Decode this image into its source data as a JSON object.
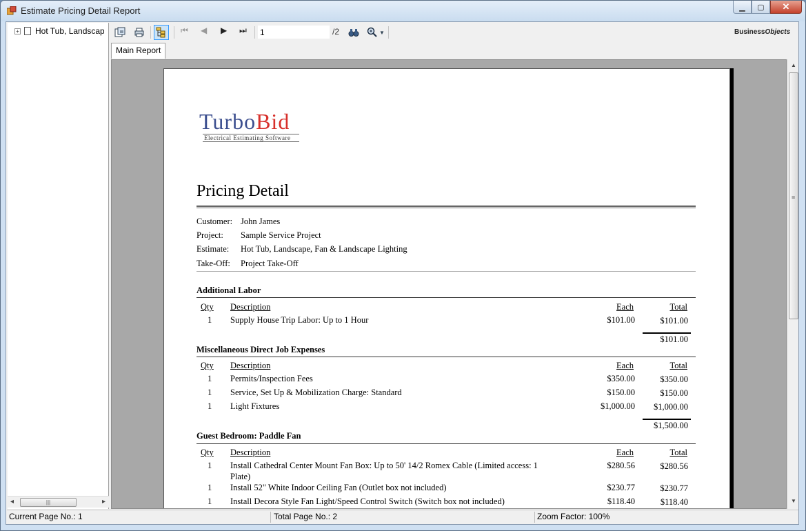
{
  "window": {
    "title": "Estimate Pricing Detail Report"
  },
  "tree": {
    "root_label": "Hot Tub, Landscape, Fan & Landscape Lighting",
    "expander": "+"
  },
  "toolbar": {
    "page_input": "1",
    "page_total": "/2",
    "logo_text": "Business",
    "logo_text2": "Objects"
  },
  "tabs": [
    {
      "label": "Main Report"
    }
  ],
  "report": {
    "logo": {
      "text1": "Turbo",
      "text2": "Bid",
      "subtitle": "Electrical Estimating Software"
    },
    "title": "Pricing Detail",
    "info": [
      {
        "label": "Customer:",
        "value": "John James"
      },
      {
        "label": "Project:",
        "value": "Sample Service Project"
      },
      {
        "label": "Estimate:",
        "value": "Hot Tub, Landscape, Fan & Landscape Lighting"
      },
      {
        "label": "Take-Off:",
        "value": "Project Take-Off"
      }
    ],
    "columns": {
      "qty": "Qty",
      "desc": "Description",
      "each": "Each",
      "total": "Total"
    },
    "sections": [
      {
        "title": "Additional Labor",
        "rows": [
          {
            "qty": "1",
            "desc": "Supply House Trip Labor: Up to 1 Hour",
            "each": "$101.00",
            "total": "$101.00"
          }
        ],
        "subtotal": "$101.00"
      },
      {
        "title": "Miscellaneous Direct Job Expenses",
        "rows": [
          {
            "qty": "1",
            "desc": "Permits/Inspection Fees",
            "each": "$350.00",
            "total": "$350.00"
          },
          {
            "qty": "1",
            "desc": "Service, Set Up & Mobilization Charge: Standard",
            "each": "$150.00",
            "total": "$150.00"
          },
          {
            "qty": "1",
            "desc": "Light Fixtures",
            "each": "$1,000.00",
            "total": "$1,000.00"
          }
        ],
        "subtotal": "$1,500.00"
      },
      {
        "title": "Guest Bedroom: Paddle Fan",
        "rows": [
          {
            "qty": "1",
            "desc": "Install Cathedral Center Mount Fan Box: Up to 50' 14/2 Romex Cable (Limited access: 1",
            "desc2": "Plate)",
            "each": "$280.56",
            "total": "$280.56"
          },
          {
            "qty": "1",
            "desc": "Install 52\" White Indoor Ceiling Fan (Outlet box not included)",
            "each": "$230.77",
            "total": "$230.77"
          },
          {
            "qty": "1",
            "desc": "Install Decora Style Fan Light/Speed Control Switch (Switch box not included)",
            "each": "$118.40",
            "total": "$118.40"
          }
        ]
      }
    ]
  },
  "status": {
    "current_page": "Current Page No.: 1",
    "total_page": "Total Page No.: 2",
    "zoom": "Zoom Factor: 100%"
  }
}
